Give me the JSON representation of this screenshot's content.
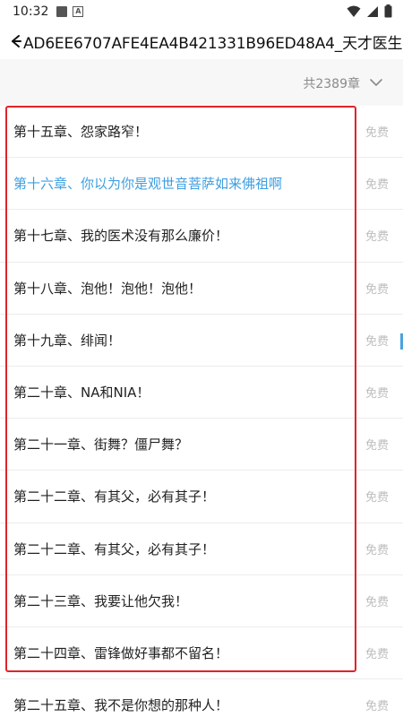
{
  "status_bar": {
    "time": "10:32",
    "icons": [
      "notification-square-icon",
      "a-icon",
      "wifi-icon",
      "signal-icon",
      "battery-icon"
    ]
  },
  "toolbar": {
    "back_icon": "back-arrow-icon",
    "title": "AD6EE6707AFE4EA4B421331B96ED48A4_天才医生"
  },
  "list_header": {
    "chapter_count": "共2389章",
    "sort_icon": "chevron-down-icon"
  },
  "chapters": [
    {
      "title": "第十五章、怨家路窄！",
      "badge": "免费"
    },
    {
      "title": "第十六章、你以为你是观世音菩萨如来佛祖啊",
      "badge": "免费"
    },
    {
      "title": "第十七章、我的医术没有那么廉价！",
      "badge": "免费"
    },
    {
      "title": "第十八章、泡他！泡他！泡他！",
      "badge": "免费"
    },
    {
      "title": "第十九章、绯闻！",
      "badge": "免费"
    },
    {
      "title": "第二十章、NA和NIA！",
      "badge": "免费"
    },
    {
      "title": "第二十一章、街舞？僵尸舞？",
      "badge": "免费"
    },
    {
      "title": "第二十二章、有其父，必有其子！",
      "badge": "免费"
    },
    {
      "title": "第二十二章、有其父，必有其子！",
      "badge": "免费"
    },
    {
      "title": "第二十三章、我要让他欠我！",
      "badge": "免费"
    },
    {
      "title": "第二十四章、雷锋做好事都不留名！",
      "badge": "免费"
    },
    {
      "title": "第二十五章、我不是你想的那种人！",
      "badge": "免费"
    }
  ],
  "active_chapter_index": 1,
  "colors": {
    "active_link": "#3e9ee0",
    "highlight_border": "#e0242a",
    "muted_text": "#8a8a8a"
  }
}
